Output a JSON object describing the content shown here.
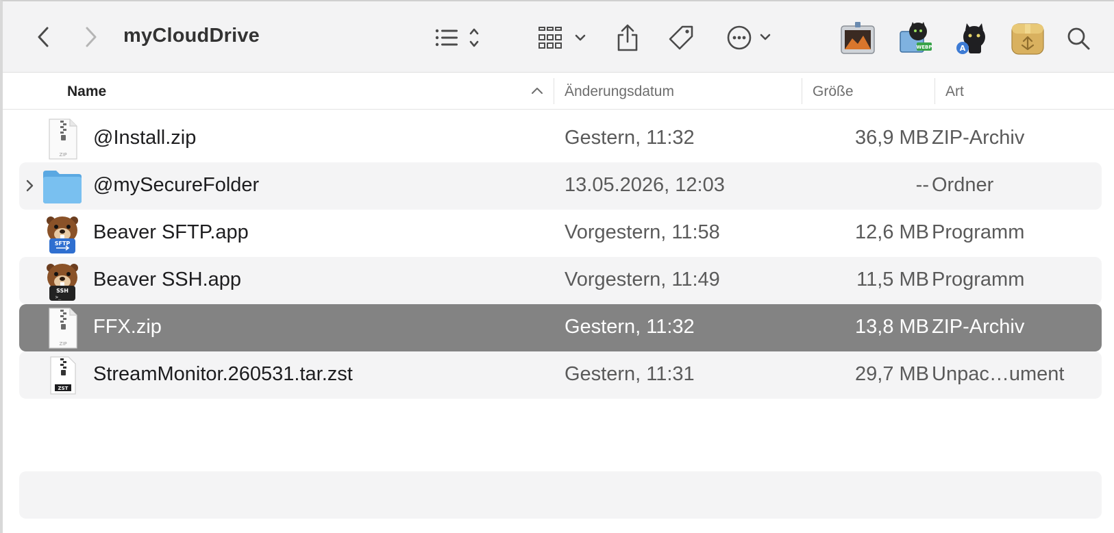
{
  "window": {
    "title": "myCloudDrive"
  },
  "toolbar": {
    "back_icon": "chevron-left-icon",
    "forward_icon": "chevron-right-icon",
    "list_view_icon": "list-view-icon",
    "grid_view_icon": "grid-view-icon",
    "share_icon": "share-icon",
    "tag_icon": "tag-icon",
    "more_icon": "ellipsis-circle-icon",
    "search_icon": "search-icon",
    "apps": [
      "preview-app-icon",
      "webp-converter-app-icon",
      "cat-app-icon",
      "archive-utility-app-icon"
    ]
  },
  "columns": {
    "name": "Name",
    "date": "Änderungsdatum",
    "size": "Größe",
    "kind": "Art"
  },
  "files": [
    {
      "name": "@Install.zip",
      "date": "Gestern, 11:32",
      "size": "36,9 MB",
      "kind": "ZIP-Archiv",
      "icon": "zip-file-icon",
      "badge": "ZIP"
    },
    {
      "name": "@mySecureFolder",
      "date": "13.05.2026, 12:03",
      "size": "--",
      "kind": "Ordner",
      "icon": "folder-icon"
    },
    {
      "name": "Beaver SFTP.app",
      "date": "Vorgestern, 11:58",
      "size": "12,6 MB",
      "kind": "Programm",
      "icon": "beaver-sftp-app-icon",
      "badge": "SFTP"
    },
    {
      "name": "Beaver SSH.app",
      "date": "Vorgestern, 11:49",
      "size": "11,5 MB",
      "kind": "Programm",
      "icon": "beaver-ssh-app-icon",
      "badge": "SSH"
    },
    {
      "name": "FFX.zip",
      "date": "Gestern, 11:32",
      "size": "13,8 MB",
      "kind": "ZIP-Archiv",
      "icon": "zip-file-icon",
      "badge": "ZIP"
    },
    {
      "name": "StreamMonitor.260531.tar.zst",
      "date": "Gestern, 11:31",
      "size": "29,7 MB",
      "kind": "Unpac…ument",
      "icon": "zst-file-icon",
      "badge": "ZST"
    }
  ],
  "colors": {
    "selection": "#838383",
    "alt_row": "#f4f4f5",
    "folder": "#6cb8ec"
  }
}
